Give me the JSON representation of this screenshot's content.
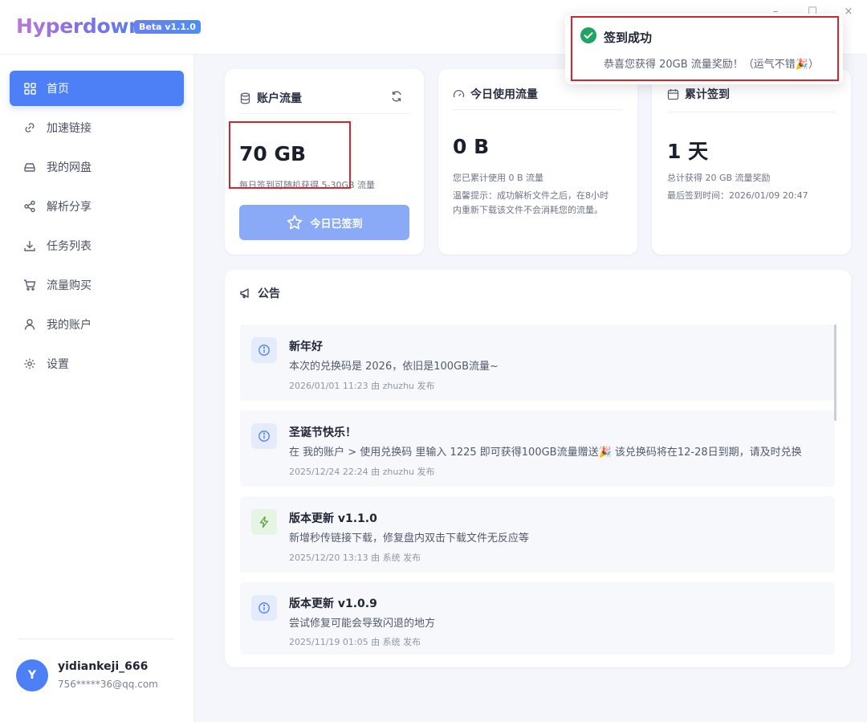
{
  "app": {
    "name": "Hyperdown",
    "badge": "Beta v1.1.0"
  },
  "window": {
    "minimize_glyph": "–",
    "maximize_glyph": "☐",
    "close_glyph": "×"
  },
  "sidebar": {
    "items": [
      {
        "label": "首页",
        "icon": "grid-icon",
        "active": true
      },
      {
        "label": "加速链接",
        "icon": "link-icon"
      },
      {
        "label": "我的网盘",
        "icon": "drive-icon"
      },
      {
        "label": "解析分享",
        "icon": "share-icon"
      },
      {
        "label": "任务列表",
        "icon": "download-icon"
      },
      {
        "label": "流量购买",
        "icon": "cart-icon"
      },
      {
        "label": "我的账户",
        "icon": "user-icon"
      },
      {
        "label": "设置",
        "icon": "gear-icon"
      }
    ],
    "user": {
      "avatar_letter": "Y",
      "name": "yidiankeji_666",
      "email": "756*****36@qq.com"
    }
  },
  "cards": {
    "account": {
      "title": "账户流量",
      "value": "70 GB",
      "hint": "每日签到可随机获得 5-30GB 流量",
      "button": "今日已签到"
    },
    "today": {
      "title": "今日使用流量",
      "value": "0 B",
      "line1": "您已累计使用 0 B 流量",
      "line2": "温馨提示：成功解析文件之后，在8小时",
      "line3": "内重新下载该文件不会消耗您的流量。"
    },
    "streak": {
      "title": "累计签到",
      "value": "1 天",
      "line1": "总计获得 20 GB 流量奖励",
      "line2": "最后签到时间：2026/01/09 20:47"
    }
  },
  "announcements": {
    "title": "公告",
    "items": [
      {
        "title": "新年好",
        "body": "本次的兑换码是 2026，依旧是100GB流量~",
        "meta": "2026/01/01 11:23   由 zhuzhu 发布",
        "icon": "info-icon"
      },
      {
        "title": "圣诞节快乐！",
        "body": "在 我的账户 > 使用兑换码 里输入 1225 即可获得100GB流量赠送🎉 该兑换码将在12-28日到期，请及时兑换",
        "meta": "2025/12/24 22:24   由 zhuzhu 发布",
        "icon": "info-icon"
      },
      {
        "title": "版本更新 v1.1.0",
        "body": "新增秒传链接下载，修复盘内双击下载文件无反应等",
        "meta": "2025/12/20 13:13   由 系统 发布",
        "icon": "bolt-icon"
      },
      {
        "title": "版本更新 v1.0.9",
        "body": "尝试修复可能会导致闪退的地方",
        "meta": "2025/11/19 01:05   由 系统 发布",
        "icon": "info-icon"
      }
    ]
  },
  "toast": {
    "title": "签到成功",
    "message": "恭喜您获得 20GB 流量奖励！（运气不错🎉）"
  },
  "colors": {
    "accent": "#4d7ff6",
    "success": "#1fa463",
    "highlight": "#d6262b"
  }
}
